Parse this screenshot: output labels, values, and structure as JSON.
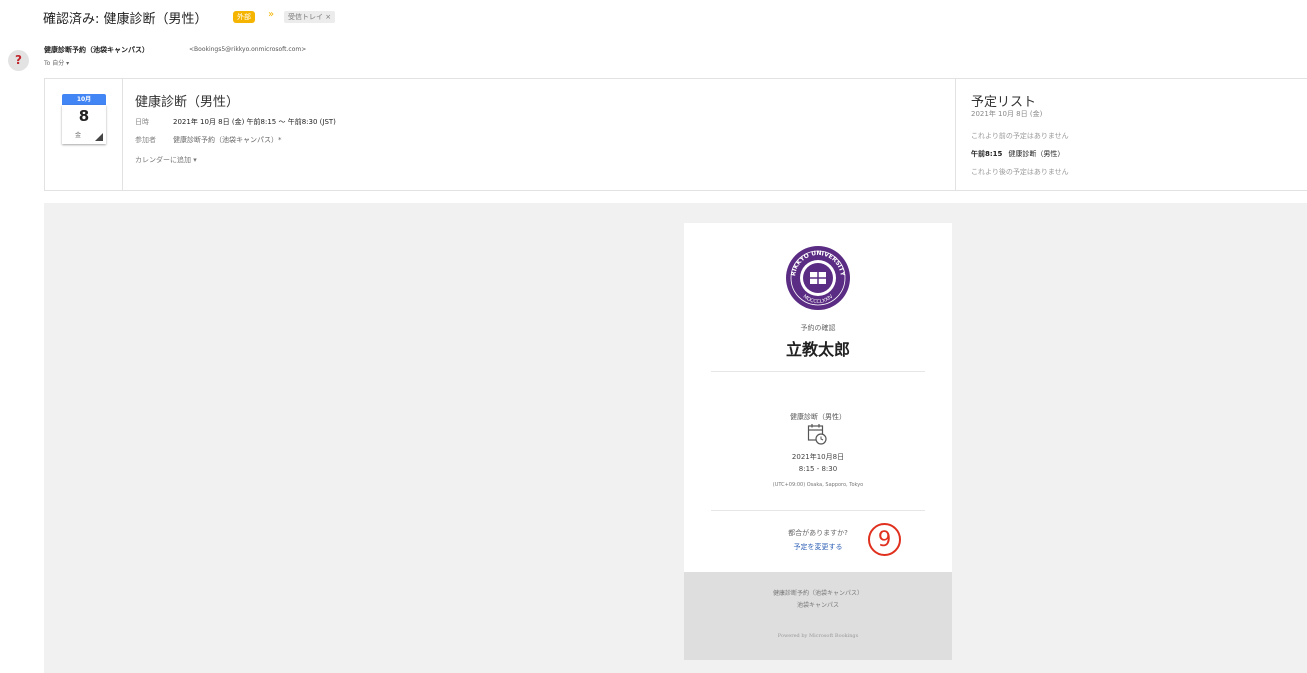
{
  "header": {
    "subject": "確認済み: 健康診断（男性）",
    "badge_external": "外部",
    "importance_marker": "»",
    "badge_inbox": "受信トレイ ×"
  },
  "sender": {
    "avatar_glyph": "?",
    "name": "健康診断予約（池袋キャンパス）",
    "email": "<Bookings5@rikkyo.onmicrosoft.com>",
    "to_line": "To 自分 ▾"
  },
  "invite": {
    "month": "10月",
    "day": "8",
    "weekday": "金",
    "title": "健康診断（男性）",
    "time_label": "日時",
    "time_value": "2021年 10月 8日 (金) 午前8:15 ～ 午前8:30 (JST)",
    "attendee_label": "参加者",
    "attendee_value": "健康診断予約（池袋キャンパス）*",
    "add_calendar": "カレンダーに追加 ▾"
  },
  "agenda": {
    "title": "予定リスト",
    "date": "2021年 10月 8日 (金)",
    "before": "これより前の予定はありません",
    "event_time": "午前8:15",
    "event_title": "健康診断（男性）",
    "after": "これより後の予定はありません"
  },
  "confirmation": {
    "label": "予約の確認",
    "customer_name": "立教太郎",
    "service": "健康診断（男性）",
    "date": "2021年10月8日",
    "time": "8:15 - 8:30",
    "timezone": "(UTC+09:00) Osaka, Sapporo, Tokyo",
    "question": "都合がありますか?",
    "change_link": "予定を変更する",
    "step_number": "9",
    "footer_line1": "健康診断予約（池袋キャンパス）",
    "footer_line2": "池袋キャンパス",
    "powered_by": "Powered by Microsoft Bookings"
  },
  "logo_text": {
    "top": "RIKKYO UNIVERSITY",
    "bottom": "MDCCCLXXIV"
  },
  "colors": {
    "calendar_blue": "#4285f4",
    "badge_yellow": "#f4b400",
    "link_blue": "#2d5fb4",
    "annotation_red": "#e0301e",
    "logo_purple": "#5b2c83"
  }
}
